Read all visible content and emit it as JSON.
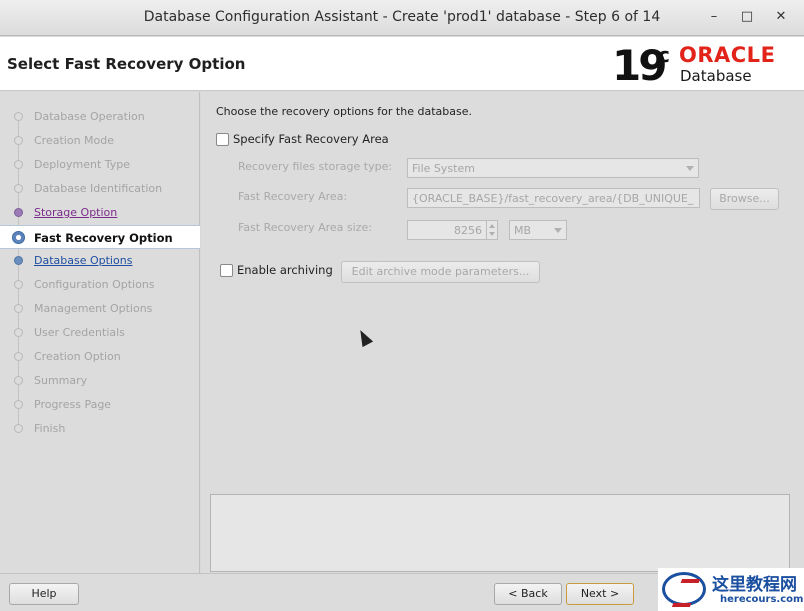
{
  "window": {
    "title": "Database Configuration Assistant - Create 'prod1' database - Step 6 of 14",
    "minimize_glyph": "–",
    "maximize_glyph": "□",
    "close_glyph": "✕"
  },
  "header": {
    "page_title": "Select Fast Recovery Option",
    "logo_version": "19",
    "logo_version_suffix": "c",
    "logo_brand": "ORACLE",
    "logo_product": "Database"
  },
  "nav": {
    "items": [
      {
        "label": "Database Operation",
        "state": "pending"
      },
      {
        "label": "Creation Mode",
        "state": "pending"
      },
      {
        "label": "Deployment Type",
        "state": "pending"
      },
      {
        "label": "Database Identification",
        "state": "pending"
      },
      {
        "label": "Storage Option",
        "state": "visited"
      },
      {
        "label": "Fast Recovery Option",
        "state": "current"
      },
      {
        "label": "Database Options",
        "state": "link"
      },
      {
        "label": "Configuration Options",
        "state": "pending"
      },
      {
        "label": "Management Options",
        "state": "pending"
      },
      {
        "label": "User Credentials",
        "state": "pending"
      },
      {
        "label": "Creation Option",
        "state": "pending"
      },
      {
        "label": "Summary",
        "state": "pending"
      },
      {
        "label": "Progress Page",
        "state": "pending"
      },
      {
        "label": "Finish",
        "state": "pending"
      }
    ]
  },
  "main": {
    "intro": "Choose the recovery options for the database.",
    "specify_fra": {
      "label": "Specify Fast Recovery Area",
      "checked": false
    },
    "storage_type": {
      "label": "Recovery files storage type:",
      "value": "File System"
    },
    "fra_location": {
      "label": "Fast Recovery Area:",
      "value": "{ORACLE_BASE}/fast_recovery_area/{DB_UNIQUE_",
      "browse_label": "Browse..."
    },
    "fra_size": {
      "label": "Fast Recovery Area size:",
      "value": "8256",
      "unit": "MB"
    },
    "archiving": {
      "label": "Enable archiving",
      "checked": false,
      "edit_label": "Edit archive mode parameters..."
    }
  },
  "footer": {
    "help_label": "Help",
    "back_label": "< Back",
    "next_label": "Next >"
  },
  "watermark": {
    "brand": "这里教程网",
    "url": "herecours.com"
  },
  "colors": {
    "oracle_red": "#e2231a",
    "link_blue": "#1f4ea0",
    "visited_purple": "#7a2e8a",
    "watermark_blue": "#1b4fa0"
  }
}
